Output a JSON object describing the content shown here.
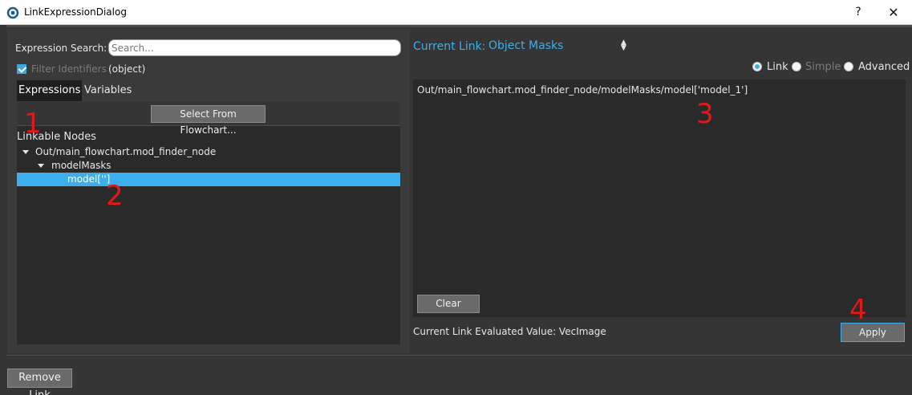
{
  "window": {
    "title": "LinkExpressionDialog",
    "help_label": "?",
    "close_label": "✕"
  },
  "search": {
    "label": "Expression Search:",
    "placeholder": "Search...",
    "filter_label": "Filter Identifiers",
    "filter_checked": true,
    "object_label": "(object)"
  },
  "tabs": [
    {
      "label": "Expressions",
      "active": true
    },
    {
      "label": "Variables In",
      "active": false
    }
  ],
  "flowchart_button": "Select From Flowchart...",
  "tree": {
    "header": "Linkable Nodes",
    "rows": [
      {
        "label": "Out/main_flowchart.mod_finder_node",
        "expanded": true,
        "selected": false
      },
      {
        "label": "modelMasks",
        "expanded": true,
        "selected": false
      },
      {
        "label": "model['']",
        "expanded": false,
        "selected": true
      }
    ]
  },
  "current_link": {
    "label": "Current Link:",
    "value": "Object Masks"
  },
  "modes": [
    {
      "label": "Link",
      "checked": true,
      "enabled": true
    },
    {
      "label": "Simple",
      "checked": false,
      "enabled": false
    },
    {
      "label": "Advanced",
      "checked": false,
      "enabled": true
    }
  ],
  "expression": "Out/main_flowchart.mod_finder_node/modelMasks/model['model_1']",
  "clear_button": "Clear",
  "evaluated": "Current Link Evaluated Value: VecImage",
  "apply_button": "Apply",
  "remove_button": "Remove Link",
  "annotations": [
    "1",
    "2",
    "3",
    "4"
  ],
  "colors": {
    "accent": "#3daee9",
    "marker": "#e01a1a",
    "background": "#353535"
  }
}
